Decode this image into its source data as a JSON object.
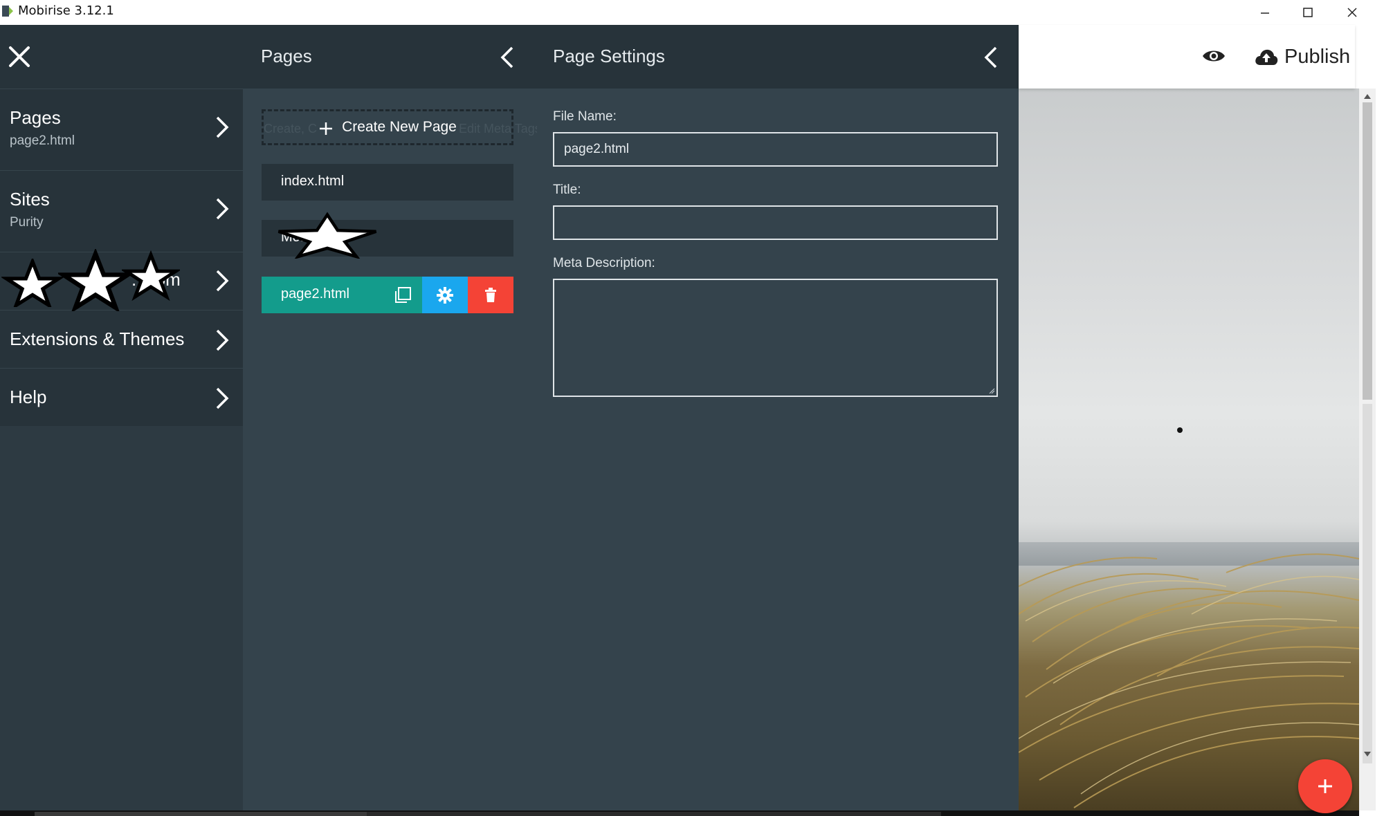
{
  "window": {
    "title": "Mobirise 3.12.1",
    "controls": [
      "minimize",
      "maximize",
      "close"
    ]
  },
  "menu": {
    "items": [
      {
        "label": "Pages",
        "sub": "page2.html"
      },
      {
        "label": "Sites",
        "sub": "Purity"
      },
      {
        "label": "...com",
        "sub": ""
      },
      {
        "label": "Extensions & Themes",
        "sub": ""
      },
      {
        "label": "Help",
        "sub": ""
      }
    ]
  },
  "pages_panel": {
    "title": "Pages",
    "create_label": "Create New Page",
    "ghost_left": "Create, C",
    "ghost_right": "Edit Meta Tags",
    "pages": [
      {
        "name": "index.html"
      },
      {
        "name": "Mo...ml"
      },
      {
        "name": "page2.html",
        "active": true
      }
    ]
  },
  "settings_panel": {
    "title": "Page Settings",
    "file_name_label": "File Name:",
    "file_name_value": "page2.html",
    "title_label": "Title:",
    "title_value": "",
    "meta_label": "Meta Description:",
    "meta_value": ""
  },
  "toolbar": {
    "publish_label": "Publish"
  },
  "colors": {
    "menu_bg": "#27333a",
    "panel_bg": "#34434c",
    "active_page": "#139c8c",
    "settings_btn": "#1aa7ee",
    "delete_btn": "#f44336",
    "fab": "#f44336"
  },
  "icons": {
    "close": "close-icon",
    "chevron": "chevron-right-icon",
    "back": "chevron-left-icon",
    "duplicate": "duplicate-icon",
    "settings": "gear-icon",
    "delete": "trash-icon",
    "preview": "eye-icon",
    "publish": "cloud-upload-icon",
    "add": "plus-icon"
  }
}
